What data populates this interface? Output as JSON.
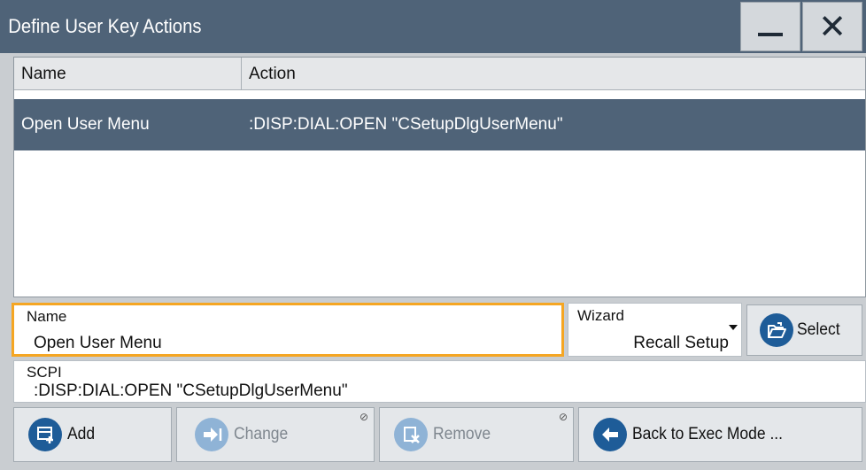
{
  "window": {
    "title": "Define User Key Actions",
    "minimize_icon": "minimize-icon",
    "close_icon": "close-icon"
  },
  "table": {
    "columns": [
      "Name",
      "Action"
    ],
    "rows": [
      {
        "name": "Open User Menu",
        "action": ":DISP:DIAL:OPEN \"CSetupDlgUserMenu\"",
        "selected": true
      }
    ]
  },
  "name_field": {
    "label": "Name",
    "value": "Open User Menu"
  },
  "wizard_field": {
    "label": "Wizard",
    "value": "Recall Setup"
  },
  "select_button": {
    "label": "Select",
    "icon": "folder-open-icon"
  },
  "scpi_field": {
    "label": "SCPI",
    "value": ":DISP:DIAL:OPEN \"CSetupDlgUserMenu\""
  },
  "buttons": {
    "add": {
      "label": "Add",
      "icon": "add-icon"
    },
    "change": {
      "label": "Change",
      "icon": "arrow-right-icon",
      "disabled": true
    },
    "remove": {
      "label": "Remove",
      "icon": "remove-icon",
      "disabled": true
    },
    "back": {
      "label": "Back to Exec Mode ...",
      "icon": "arrow-left-icon"
    }
  },
  "colors": {
    "titlebar": "#4f6378",
    "selection": "#4f6378",
    "focus_border": "#f5a623",
    "icon_blue": "#1e5c98"
  }
}
